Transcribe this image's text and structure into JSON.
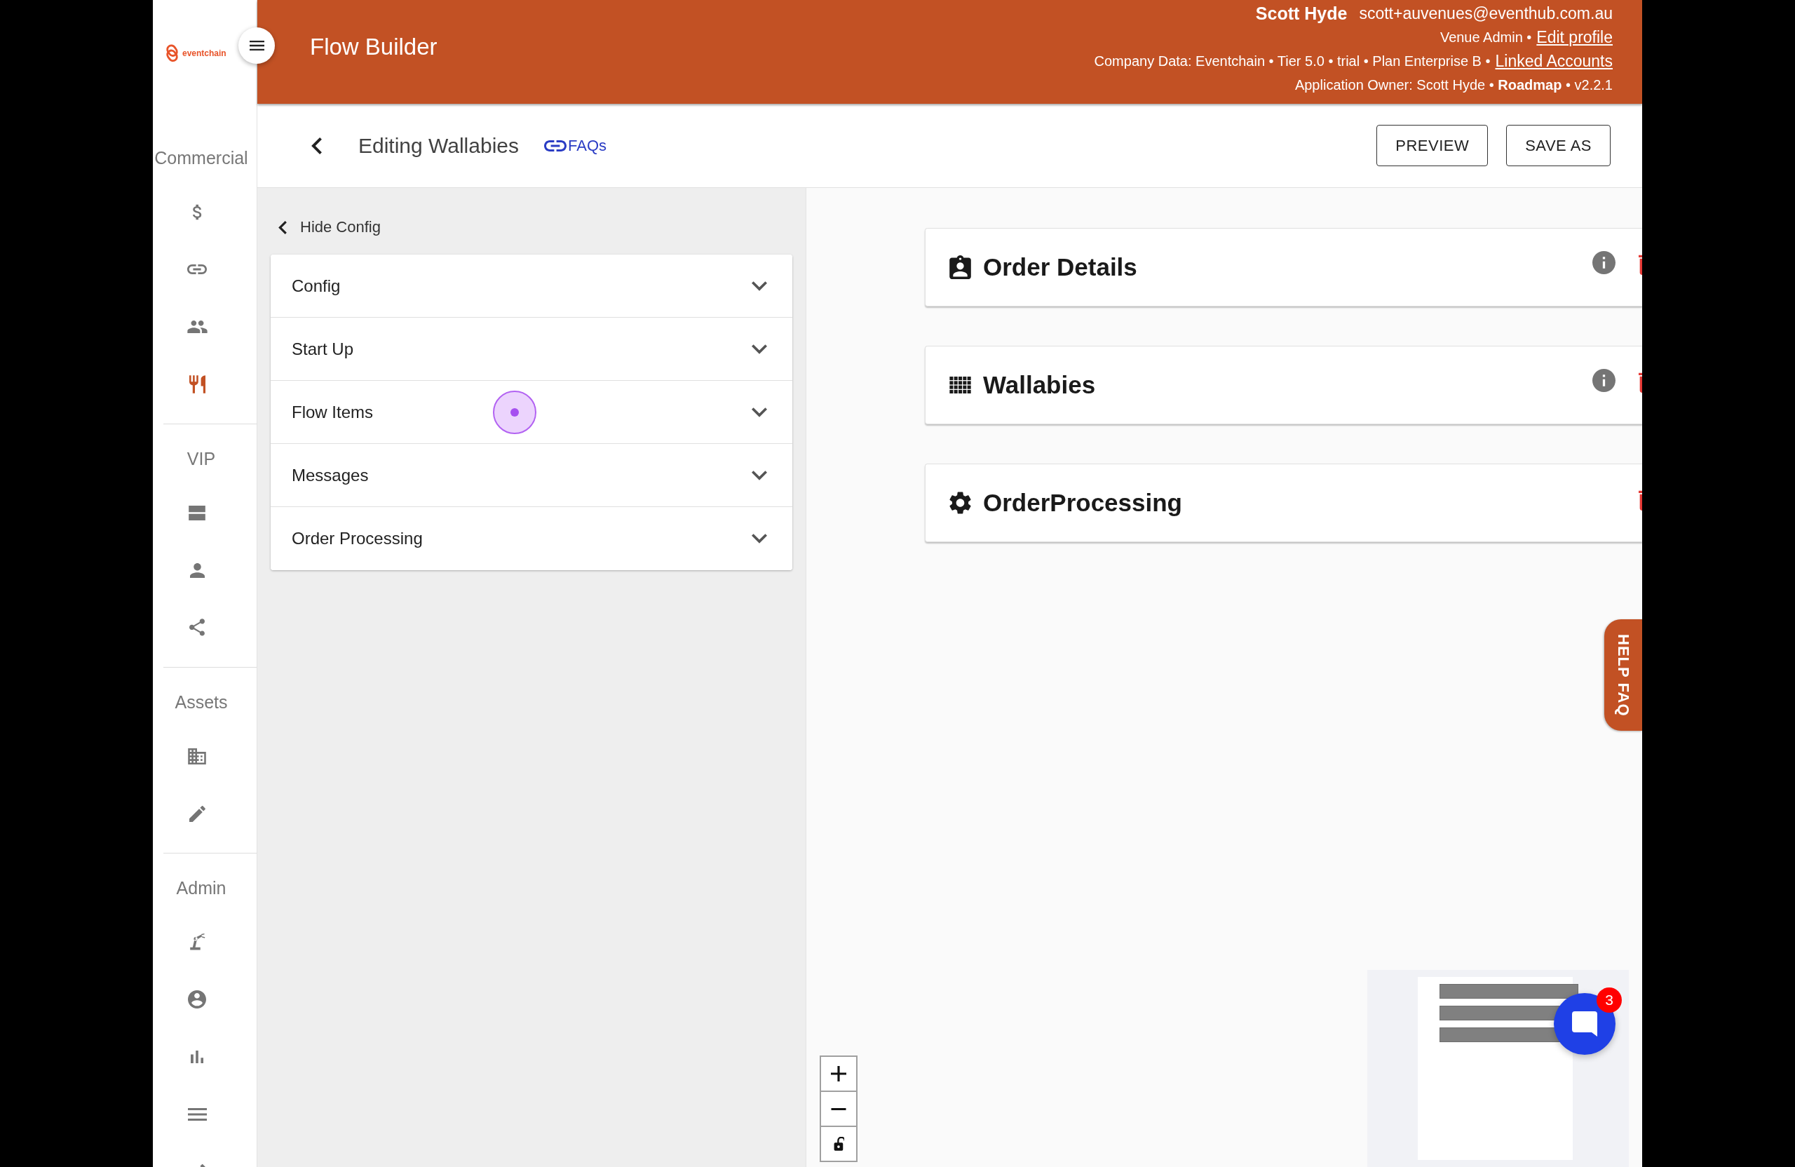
{
  "sidebar": {
    "logo": "eventchain",
    "sections": [
      {
        "title": "Commercial",
        "items": [
          {
            "selected": false
          },
          {
            "selected": false
          },
          {
            "selected": false
          },
          {
            "selected": true
          }
        ]
      },
      {
        "title": "VIP",
        "items": [
          {
            "selected": false
          },
          {
            "selected": false
          },
          {
            "selected": false
          }
        ]
      },
      {
        "title": "Assets",
        "items": [
          {
            "selected": false
          },
          {
            "selected": false
          }
        ]
      },
      {
        "title": "Admin",
        "items": [
          {
            "selected": false
          },
          {
            "selected": false
          },
          {
            "selected": false
          },
          {
            "selected": false
          },
          {
            "selected": false
          }
        ]
      }
    ]
  },
  "header": {
    "title": "Flow Builder",
    "user_name": "Scott Hyde",
    "email": "scott+auvenues@eventhub.com.au",
    "role": "Venue Admin •",
    "edit_profile": "Edit profile",
    "company": "Company Data: Eventchain • Tier 5.0 • trial • Plan Enterprise B •",
    "linked_accounts": "Linked Accounts",
    "owner": "Application Owner: Scott Hyde • **Roadmap** • v2.2.1"
  },
  "toolbar": {
    "title": "Editing Wallabies",
    "faq_link": "FAQs",
    "buttons": [
      "PREVIEW",
      "SAVE AS"
    ]
  },
  "config_panel": {
    "hide_label": "Hide Config",
    "sections": [
      {
        "label": "Config",
        "expanded": false
      },
      {
        "label": "Start Up",
        "expanded": false
      },
      {
        "label": "Flow Items",
        "expanded": false
      },
      {
        "label": "Messages",
        "expanded": false
      },
      {
        "label": "Order Processing",
        "expanded": false
      }
    ]
  },
  "canvas": {
    "nodes": [
      {
        "title": "Order Details",
        "info": true
      },
      {
        "title": "Wallabies",
        "info": true
      },
      {
        "title": "OrderProcessing",
        "info": false
      }
    ],
    "help_tab": "HELP FAQ",
    "chat_badge": "3"
  }
}
